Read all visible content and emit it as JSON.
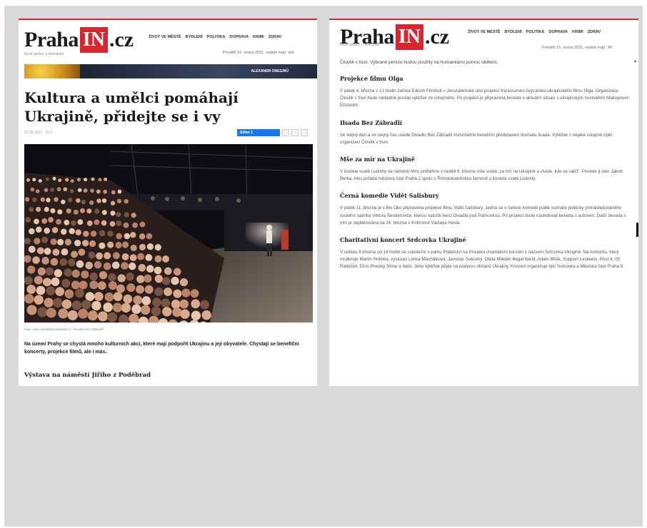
{
  "site": {
    "logo_left": "Praha",
    "logo_in": "IN",
    "logo_right": ".cz",
    "tagline": "Nové zprávy z metropole"
  },
  "nav": [
    "ŽIVOT VE MĚSTĚ",
    "BYDLENÍ",
    "POLITIKA",
    "DOPRAVA",
    "KRIMI",
    "ZDRAV"
  ],
  "date_left": "Pondělí 15. února 2021, svátek mají: ská",
  "date_right": "Pondělí 15. února 2021, svátek mají: Jiři",
  "banner_text": "ALEXANDR ONEGINŮ",
  "left": {
    "title": "Kultura a umělci pomáhají Ukrajině, přidejte se i vy",
    "meta": "01.03.2022 · 21:0",
    "share_label": "Sdílet 1",
    "caption": "Foto: www.divadlobezzabradli.cz / Divadlo Bez Zábradlí",
    "perex": "Na území Prahy se chystá mnoho kulturních akcí, které mají podpořit Ukrajinu a její obyvatele. Chystají se benefiční koncerty, projekce filmů, ale i más.",
    "subhead": "Výstava na náměstí Jiřího z Poděbrad"
  },
  "right": {
    "intro": "Člověk v tísni. Vybrané peníze budou použity na humanitární pomoc obětem.",
    "sections": [
      {
        "h": "Projekce filmu Olga",
        "p": "V pátek 4. března v 13 hodin začíná Edison Filmhub v Jeruzalémské ulici projekcí francouzsko-švýcarsko-ukrajinského filmu Olga. Organizace Člověk v tísni bude následně posílat výtěžek ze vstupného. Po projekci je připravena beseda o aktuální situaci s ukrajinským novinářem Maksymem Eristavim."
      },
      {
        "h": "Ilsada Bez Zábradlí",
        "p": "Ve stejný den a ve stejný čas uvede Divadlo Bez Zábradlí mimořádné benefiční představení dramatu Ilsada. Výtěžek z nějaké vstupné opět organizaci Člověk v tísni."
      },
      {
        "h": "Mše za mír na Ukrajině",
        "p": "V kostele svaté Ludmily na náměstí Míru proběhne v neděli 6. března mše svatá „za mír na Ukrajině a všude, kde se válčí\". Povede ji otec Jakub Berka. Akci pořádá městská část Praha 2 spolu s Římskokatolickou farností u kostela svaté Ludmily."
      },
      {
        "h": "Černá komedie Vidět Salisbury",
        "p": "V pátek 11. března je v Bio Oko připravena projekce filmu Vidět Salisbury. Jedná se o černou komedii podle scénáře politicky pronásledovaného ruského satirika Viktora Šenderoviče, kterou natočili herci Divadla pod Palmovkou. Po projekci bude následovat beseda s autorem. Další beseda s ním je naplánována na 14. března v Knihovně Václava Havla."
      },
      {
        "h": "Charitativní koncert Srdcovka Ukrajiné",
        "p": "V sobotu 8.března od 14 hodin se uskuteční v parku Přátelství na Proseku charitativní koncert s názvem Srdcovka Ukrajině. Na koncertu, který moderuje Martin Hrdinka, vystoupí Lenka Machálková, Jaroslav Svěcený, Děda Mládek Illegal Band, Adam Mišík, Support Lesbiens, Post-It, 05 Radeček, Elvis Presley Show a další. Jeho výtěžek půjde na podporu občanů Ukrajiny. Koncert organizuje tým Srdcovka a Městská část Praha 9."
      }
    ]
  }
}
